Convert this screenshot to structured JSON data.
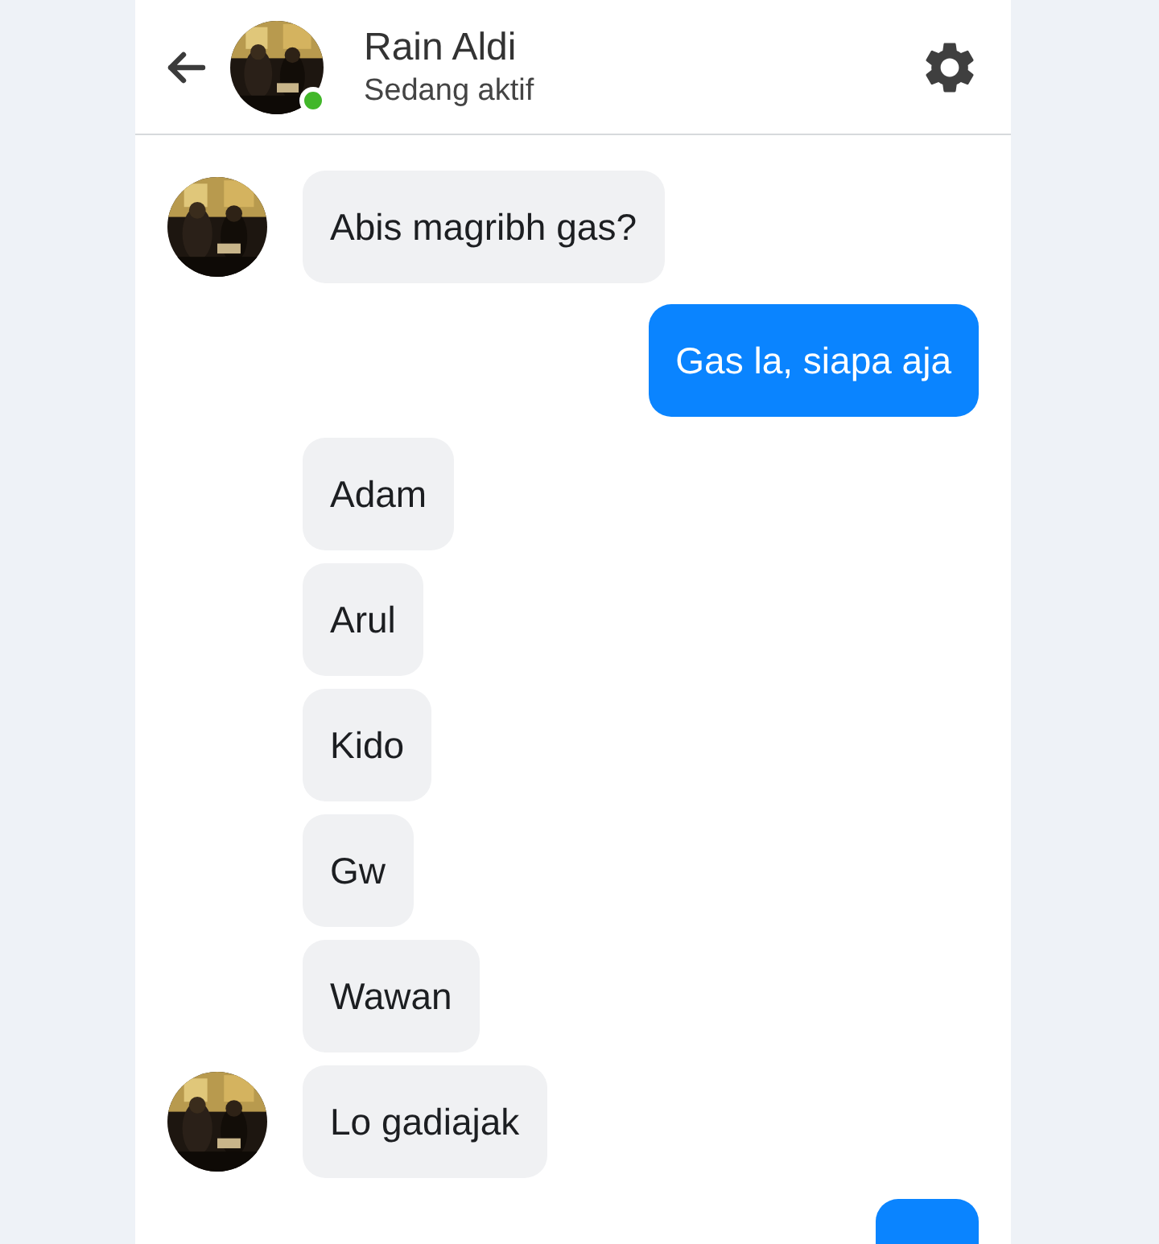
{
  "header": {
    "name": "Rain Aldi",
    "status": "Sedang aktif",
    "online": true
  },
  "messages": [
    {
      "kind": "received",
      "show_avatar": true,
      "text": "Abis magribh gas?"
    },
    {
      "kind": "sent",
      "text": "Gas la, siapa aja"
    },
    {
      "kind": "received",
      "show_avatar": false,
      "text": "Adam"
    },
    {
      "kind": "received",
      "show_avatar": false,
      "text": "Arul"
    },
    {
      "kind": "received",
      "show_avatar": false,
      "text": "Kido"
    },
    {
      "kind": "received",
      "show_avatar": false,
      "text": "Gw"
    },
    {
      "kind": "received",
      "show_avatar": false,
      "text": "Wawan"
    },
    {
      "kind": "received",
      "show_avatar": true,
      "text": "Lo gadiajak"
    },
    {
      "kind": "sent"
    }
  ]
}
